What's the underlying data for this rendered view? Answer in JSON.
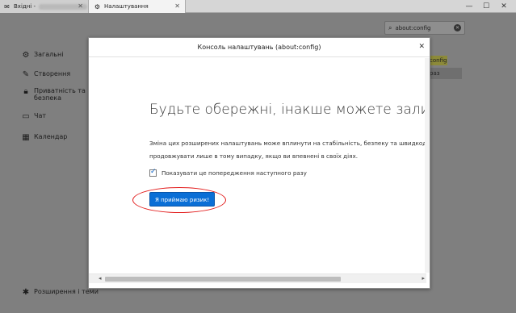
{
  "tabs": [
    {
      "label": "Вхідні -",
      "icon": "mail-icon"
    },
    {
      "label": "Налаштування",
      "icon": "gear-icon"
    }
  ],
  "window_controls": {
    "minimize": "—",
    "maximize": "☐",
    "close": "✕"
  },
  "sidebar": {
    "items": [
      {
        "label": "Загальні",
        "icon": "gear-icon"
      },
      {
        "label": "Створення",
        "icon": "pencil-icon"
      },
      {
        "label_line1": "Приватність та",
        "label_line2": "безпека",
        "icon": "lock-icon"
      },
      {
        "label": "Чат",
        "icon": "chat-icon"
      },
      {
        "label": "Календар",
        "icon": "calendar-icon"
      }
    ],
    "footer": {
      "label": "Розширення і теми",
      "icon": "puzzle-icon"
    }
  },
  "search": {
    "value": "about:config"
  },
  "background": {
    "highlight1": "config",
    "highlight2": "раз"
  },
  "dialog": {
    "title": "Консоль налаштувань (about:config)",
    "heading": "Будьте обережні, інакше можете залишитися",
    "text_line1": "Зміна цих розширених налаштувань може вплинути на стабільність, безпеку та швидкодію",
    "text_line2": "продовжувати лише в тому випадку, якщо ви впевнені в своїх діях.",
    "checkbox_label": "Показувати це попередження наступного разу",
    "checkbox_checked": true,
    "accept_button": "Я приймаю ризик!"
  },
  "colors": {
    "accent": "#0a6fd6",
    "annotation": "#e21b1b"
  }
}
